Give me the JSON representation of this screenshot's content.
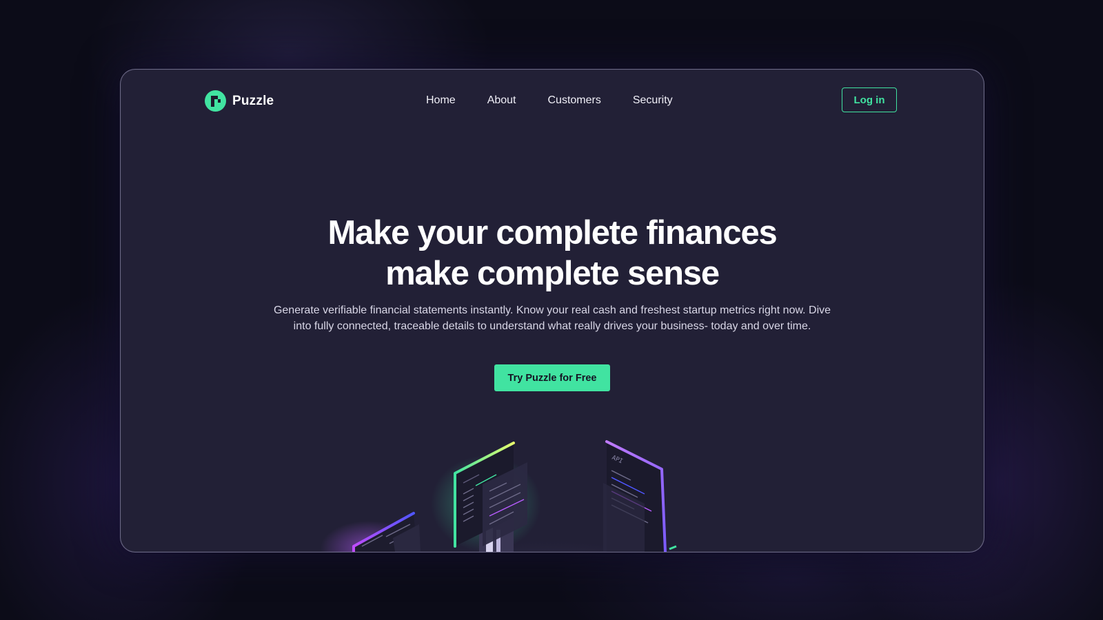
{
  "brand": {
    "name": "Puzzle"
  },
  "nav": {
    "links": [
      "Home",
      "About",
      "Customers",
      "Security"
    ],
    "login_label": "Log in"
  },
  "hero": {
    "title_line1": "Make your complete finances",
    "title_line2": "make complete sense",
    "subtitle_line1": "Generate verifiable financial statements instantly. Know your real cash and freshest startup metrics right now. Dive",
    "subtitle_line2": "into fully connected, traceable details to understand what really drives your business- today and over time.",
    "cta_label": "Try Puzzle for Free"
  },
  "illustration": {
    "api_label": "API"
  },
  "colors": {
    "accent": "#41e3a1",
    "window_bg": "#222036",
    "page_bg": "#0c0c18",
    "text": "#ffffff"
  }
}
